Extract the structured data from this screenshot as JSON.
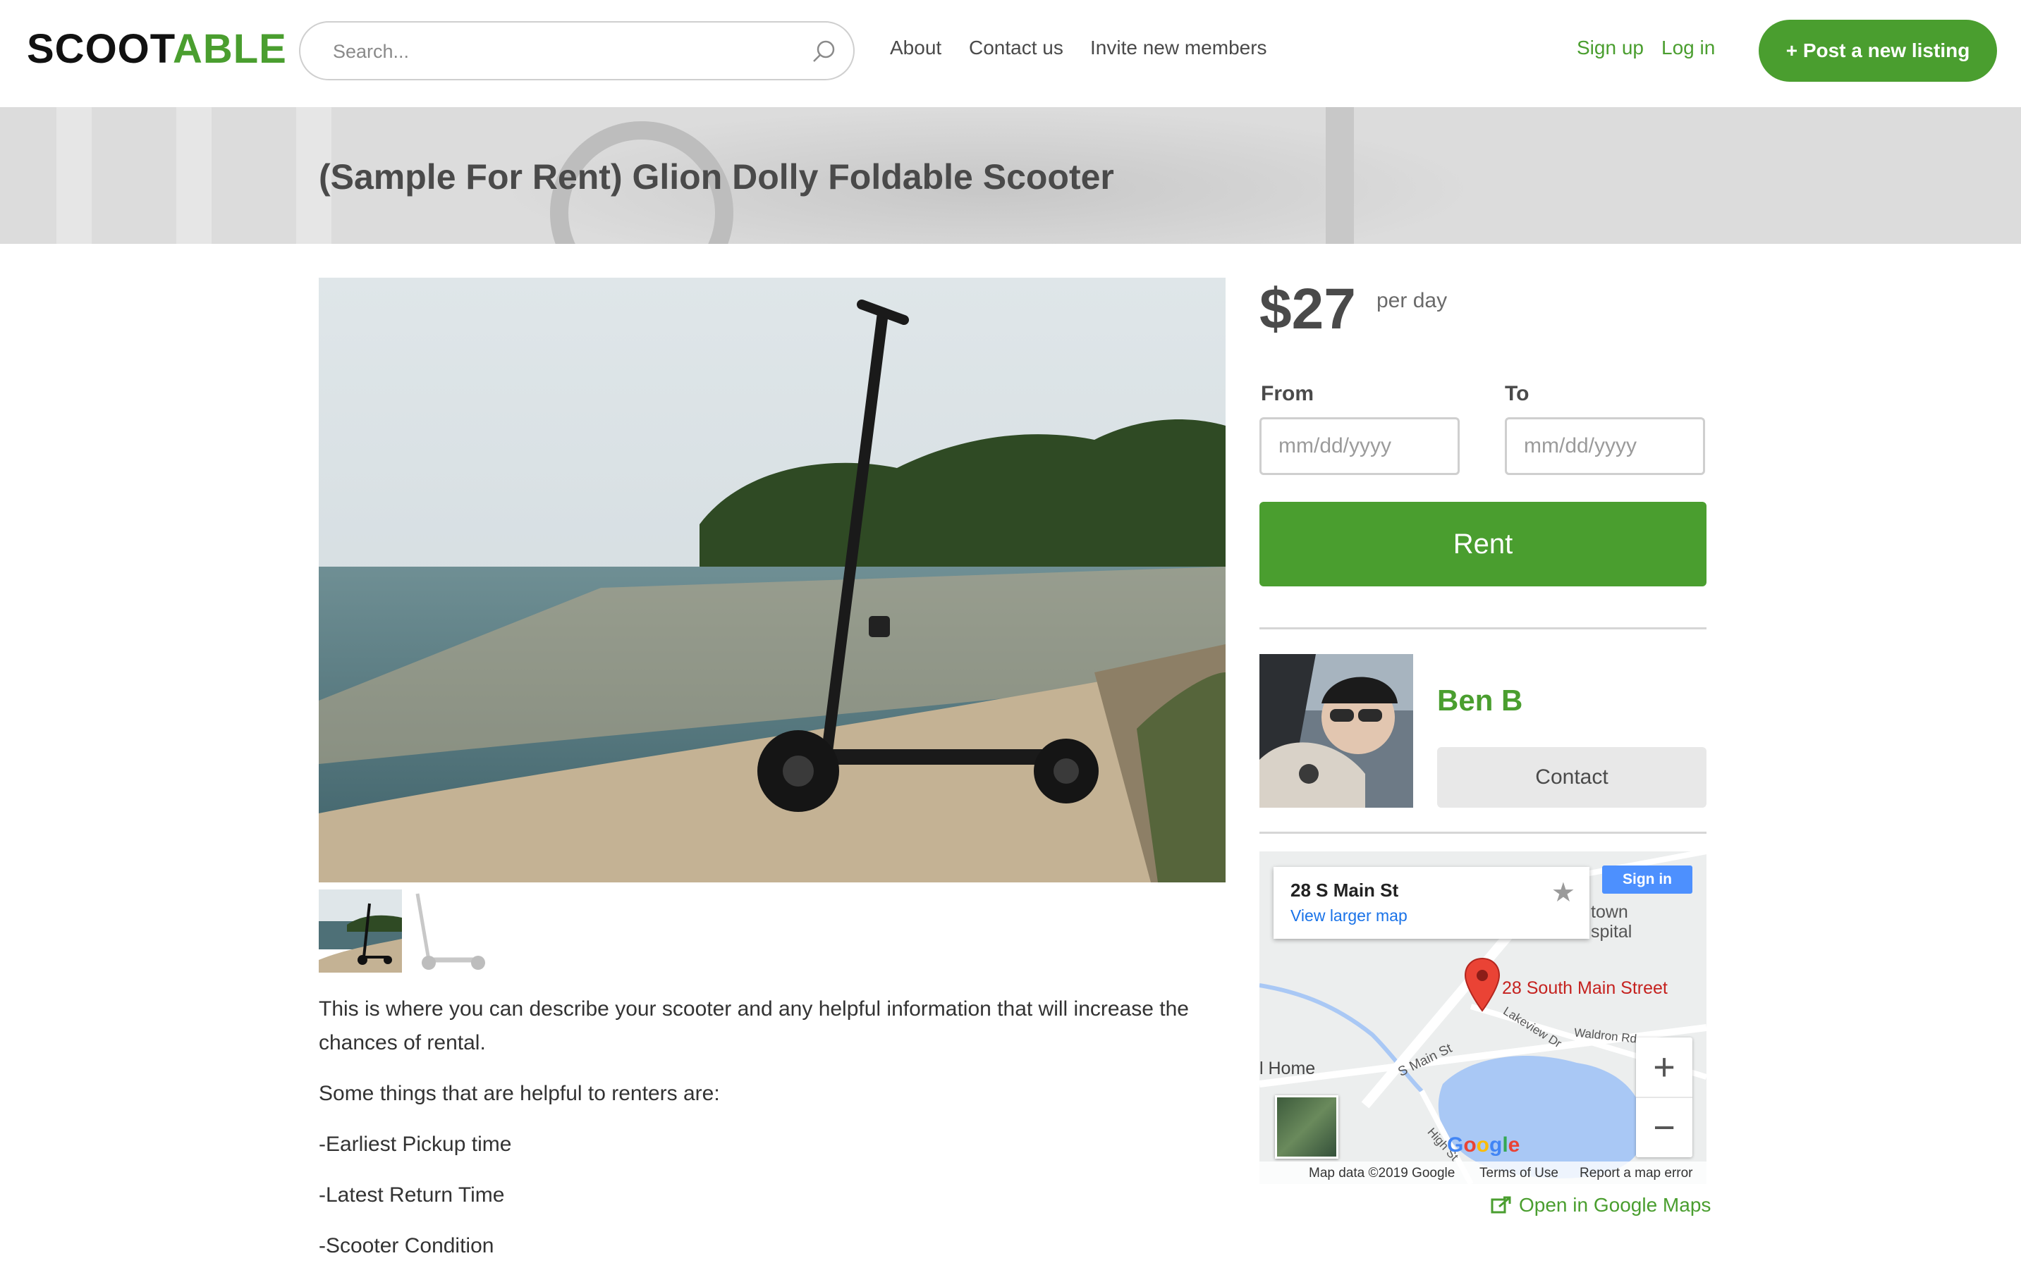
{
  "header": {
    "logo_part1": "SCOOT",
    "logo_part2": "ABLE",
    "search_placeholder": "Search...",
    "nav": [
      "About",
      "Contact us",
      "Invite new members"
    ],
    "sign_up": "Sign up",
    "log_in": "Log in",
    "post_listing": "+ Post a new listing"
  },
  "listing": {
    "title": "(Sample For Rent) Glion Dolly Foldable Scooter",
    "description": [
      "This is where you can describe your scooter and any helpful information that will increase the chances of rental.",
      "Some things that are helpful to renters are:",
      "-Earliest Pickup time",
      "-Latest Return Time",
      "-Scooter Condition"
    ]
  },
  "booking": {
    "price": "$27",
    "per": "per day",
    "from_label": "From",
    "to_label": "To",
    "date_placeholder": "mm/dd/yyyy",
    "rent_button": "Rent"
  },
  "author": {
    "name": "Ben B",
    "contact_button": "Contact"
  },
  "map": {
    "card_title": "28 S Main St",
    "card_link": "View larger map",
    "sign_in": "Sign in",
    "pin_label": "28 South Main Street",
    "home_label": "l Home",
    "street_labels": [
      "S Main St",
      "Lakeview Dr",
      "Waldron Rd",
      "High St"
    ],
    "place_fragments": [
      "town",
      "spital"
    ],
    "zoom_in": "+",
    "zoom_out": "−",
    "footer_data": "Map data ©2019 Google",
    "footer_terms": "Terms of Use",
    "footer_report": "Report a map error",
    "google": "Google",
    "open_in_maps": "Open in Google Maps"
  },
  "colors": {
    "brand_green": "#4a9e2f",
    "text": "#4a4a4a"
  }
}
